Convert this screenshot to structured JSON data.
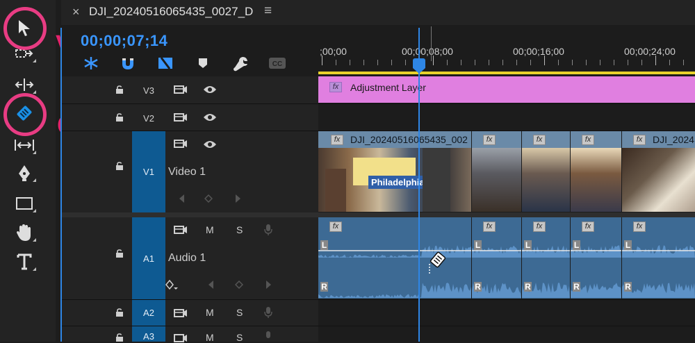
{
  "tab": {
    "close": "×",
    "title": "DJI_20240516065435_0027_D",
    "menu": "≡"
  },
  "timecode": "00;00;07;14",
  "ruler": {
    "labels": [
      ";00;00",
      "00;00;08;00",
      "00;00;16;00",
      "00;00;24;00"
    ]
  },
  "annotations": {
    "v": "V",
    "c": "C"
  },
  "tracks": {
    "v3": {
      "label": "V3"
    },
    "v2": {
      "label": "V2"
    },
    "v1": {
      "label": "V1",
      "name": "Video 1"
    },
    "a1": {
      "label": "A1",
      "name": "Audio 1",
      "m": "M",
      "s": "S"
    },
    "a2": {
      "label": "A2",
      "m": "M",
      "s": "S"
    },
    "a3": {
      "label": "A3",
      "m": "M",
      "s": "S"
    }
  },
  "clips": {
    "adjustment": {
      "label": "Adjustment Layer",
      "fx": "fx"
    },
    "video1": {
      "label": "DJI_20240516065435_002",
      "fx": "fx"
    },
    "video5": {
      "label": "DJI_2024",
      "fx": "fx"
    },
    "audio_left": "L",
    "audio_right": "R",
    "fx": "fx"
  },
  "photo_text": {
    "sign": "Philadelphia"
  },
  "colors": {
    "accent": "#3a96ff",
    "adjustment_layer": "#e17fe0",
    "audio_clip": "#4f82b5",
    "track_target": "#0e5a92",
    "annotation": "#e2236c"
  }
}
